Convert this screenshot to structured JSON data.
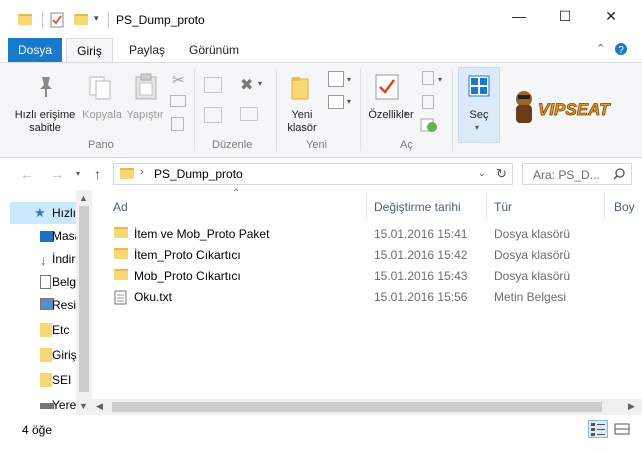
{
  "window": {
    "title": "PS_Dump_proto",
    "minimize": "—",
    "maximize": "☐",
    "close": "✕"
  },
  "tabs": {
    "file": "Dosya",
    "home": "Giriş",
    "share": "Paylaş",
    "view": "Görünüm"
  },
  "ribbon": {
    "pin_label": "Hızlı erişime sabitle",
    "copy_label": "Kopyala",
    "paste_label": "Yapıştır",
    "new_folder_label": "Yeni klasör",
    "properties_label": "Özellikler",
    "select_label": "Seç",
    "groups": {
      "clipboard": "Pano",
      "organize": "Düzenle",
      "new": "Yeni",
      "open": "Aç"
    },
    "logo_text": "VIPSEAT"
  },
  "address": {
    "path": "PS_Dump_proto",
    "search_placeholder": "Ara: PS_D..."
  },
  "navpane": {
    "items": [
      {
        "label": "Hızlı",
        "icon": "star-icon"
      },
      {
        "label": "Masaüstü",
        "icon": "desktop-icon"
      },
      {
        "label": "İndirilenler",
        "icon": "download-icon"
      },
      {
        "label": "Belgeler",
        "icon": "document-icon"
      },
      {
        "label": "Resimler",
        "icon": "picture-icon"
      },
      {
        "label": "Etc",
        "icon": "folder-icon"
      },
      {
        "label": "Giriş",
        "icon": "folder-icon"
      },
      {
        "label": "SEI",
        "icon": "folder-icon"
      },
      {
        "label": "Yerel",
        "icon": "drive-icon"
      }
    ]
  },
  "columns": {
    "name": "Ad",
    "date": "Değiştirme tarihi",
    "type": "Tür",
    "size": "Boy"
  },
  "files": [
    {
      "name": "İtem ve Mob_Proto Paket",
      "date": "15.01.2016 15:41",
      "type": "Dosya klasörü",
      "icon": "folder-icon"
    },
    {
      "name": "İtem_Proto Cıkartıcı",
      "date": "15.01.2016 15:42",
      "type": "Dosya klasörü",
      "icon": "folder-icon"
    },
    {
      "name": "Mob_Proto Cıkartıcı",
      "date": "15.01.2016 15:43",
      "type": "Dosya klasörü",
      "icon": "folder-icon"
    },
    {
      "name": "Oku.txt",
      "date": "15.01.2016 15:56",
      "type": "Metin Belgesi",
      "icon": "text-file-icon"
    }
  ],
  "status": {
    "count": "4 öğe"
  },
  "colors": {
    "accent": "#1979ca",
    "folder": "#f8d775",
    "selection": "#cce8ff"
  }
}
